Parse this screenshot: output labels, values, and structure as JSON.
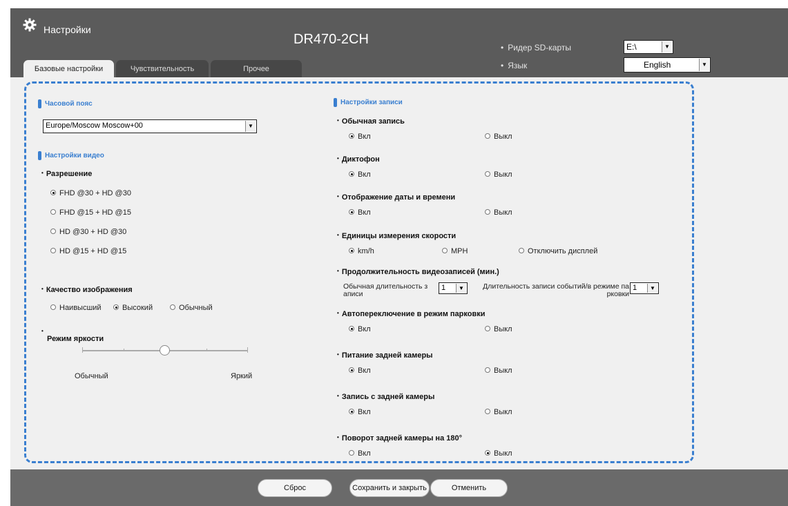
{
  "window": {
    "title": "Настройки",
    "model": "DR470-2CH"
  },
  "header": {
    "sd_label": "Ридер SD-карты",
    "sd_value": "E:\\",
    "lang_label": "Язык",
    "lang_value": "English",
    "bullet": "•"
  },
  "tabs": [
    "Базовые настройки",
    "Чувствительность",
    "Прочее"
  ],
  "left": {
    "timezone_section": "Часовой пояс",
    "timezone_value": "Europe/Moscow Moscow+00",
    "video_section": "Настройки видео",
    "resolution_title": "Разрешение",
    "resolutions": [
      "FHD @30 + HD @30",
      "FHD @15 + HD @15",
      "HD @30 + HD @30",
      "HD @15 + HD @15"
    ],
    "quality_title": "Качество изображения",
    "quality_options": [
      "Наивысший",
      "Высокий",
      "Обычный"
    ],
    "brightness_title": "Режим яркости",
    "brightness_min": "Обычный",
    "brightness_max": "Яркий",
    "brightness_level": 0.5
  },
  "right": {
    "section": "Настройки записи",
    "on": "Вкл",
    "off": "Выкл",
    "normal_rec": "Обычная запись",
    "voice_rec": "Диктофон",
    "datetime": "Отображение даты и времени",
    "speed_units": "Единицы измерения скорости",
    "speed_options": [
      "km/h",
      "MPH",
      "Отключить дисплей"
    ],
    "duration_title": "Продолжительность видеозаписей (мин.)",
    "normal_duration_label_1": "Обычная длительность з",
    "normal_duration_label_2": "аписи",
    "normal_duration_value": "1",
    "event_duration_label_1": "Длительность записи событий/в режиме па",
    "event_duration_label_2": "рковки",
    "event_duration_value": "1",
    "auto_parking": "Автопереключение в режим парковки",
    "rear_power": "Питание задней камеры",
    "rear_record": "Запись с задней камеры",
    "rear_rotate": "Поворот задней камеры на 180°"
  },
  "footer": {
    "reset": "Сброс",
    "save": "Сохранить и закрыть",
    "cancel": "Отменить"
  }
}
